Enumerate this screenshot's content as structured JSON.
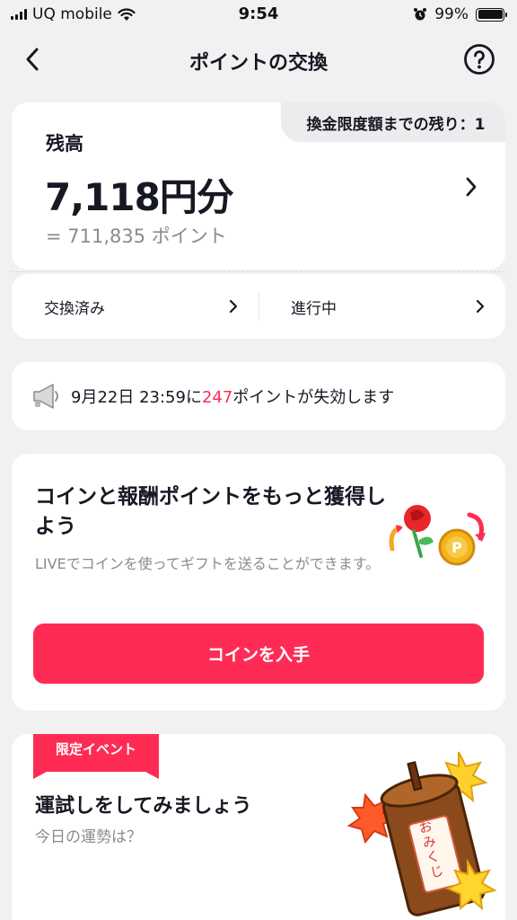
{
  "status_bar": {
    "carrier": "UQ mobile",
    "time": "9:54",
    "battery": "99%"
  },
  "nav": {
    "title": "ポイントの交換"
  },
  "balance": {
    "label": "残高",
    "amount": "7,118円分",
    "points": "= 711,835 ポイント",
    "limit_text": "換金限度額までの残り：1"
  },
  "history": {
    "exchanged": "交換済み",
    "in_progress": "進行中"
  },
  "expiry": {
    "prefix": "9月22日 23:59に",
    "points": "247",
    "suffix": "ポイントが失効します"
  },
  "promo": {
    "title": "コインと報酬ポイントをもっと獲得しよう",
    "description": "LIVEでコインを使ってギフトを送ることができます。",
    "button": "コインを入手"
  },
  "event": {
    "badge": "限定イベント",
    "title": "運試しをしてみましょう",
    "subtitle": "今日の運勢は？",
    "omikuji_text": "おみくじ"
  },
  "colors": {
    "accent": "#fe2c55",
    "background": "#f1f1f2"
  }
}
